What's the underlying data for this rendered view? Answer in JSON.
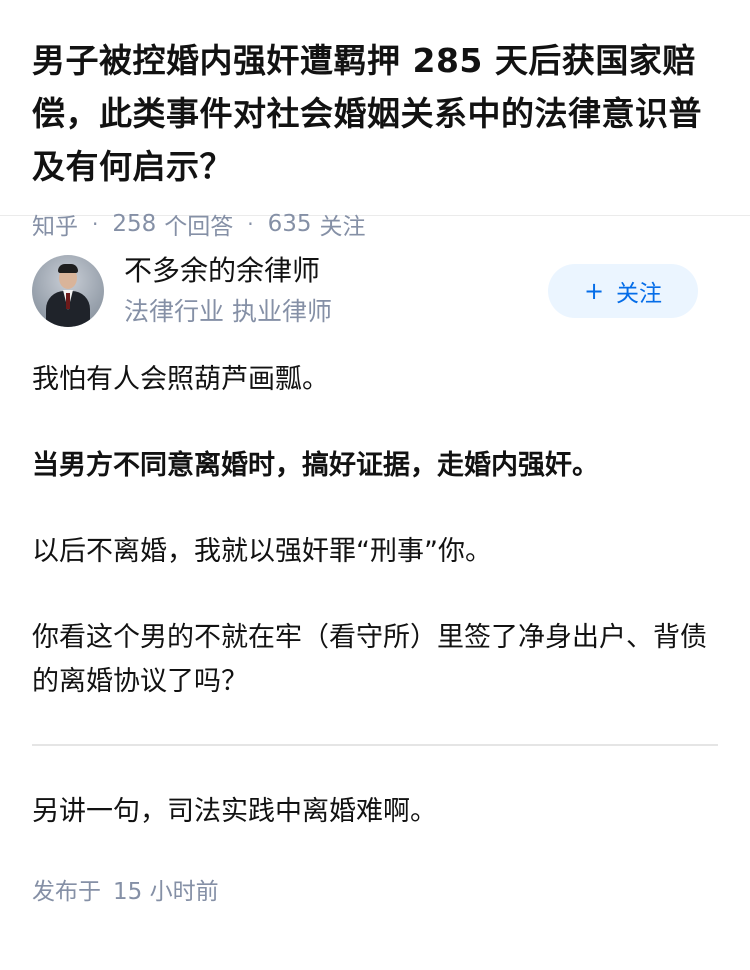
{
  "question": {
    "title": "男子被控婚内强奸遭羁押 285 天后获国家赔偿，此类事件对社会婚姻关系中的法律意识普及有何启示？",
    "source": "知乎",
    "answer_count": "258",
    "answer_label": "个回答",
    "follow_count": "635",
    "follow_label": "关注"
  },
  "author": {
    "name": "不多余的余律师",
    "badge": "法律行业 执业律师",
    "follow_button": "关注",
    "follow_icon": "plus-icon"
  },
  "answer": {
    "paragraphs": [
      "我怕有人会照葫芦画瓢。",
      "当男方不同意离婚时，搞好证据，走婚内强奸。",
      "以后不离婚，我就以强奸罪“刑事”你。",
      "你看这个男的不就在牢（看守所）里签了净身出户、背债的离婚协议了吗？",
      "另讲一句，司法实践中离婚难啊。"
    ],
    "publish_prefix": "发布于",
    "publish_time": "15 小时前"
  },
  "colors": {
    "meta_gray": "#8590a6",
    "brand_blue": "#056de8",
    "button_bg": "#ebf5ff",
    "divider": "#e5e5e5"
  }
}
